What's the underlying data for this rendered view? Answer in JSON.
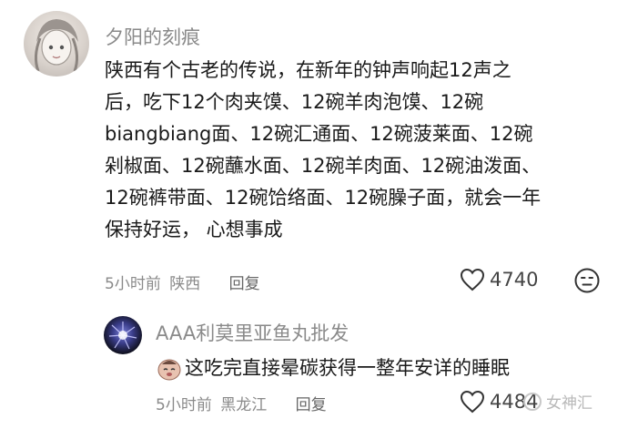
{
  "comment": {
    "username": "夕阳的刻痕",
    "lines": [
      "陕西有个古老的传说，在新年的钟声响起12声之",
      "后，吃下12个肉夹馍、12碗羊肉泡馍、12碗",
      "biangbiang面、12碗汇通面、12碗菠莱面、12碗",
      "剁椒面、12碗蘸水面、12碗羊肉面、12碗油泼面、",
      "12碗裤带面、12碗饸络面、12碗臊子面，就会一年",
      "保持好运， 心想事成"
    ],
    "time": "5小时前",
    "location": "陕西",
    "reply_label": "回复",
    "likes": "4740"
  },
  "reply": {
    "username": "AAA利莫里亚鱼丸批发",
    "text": "这吃完直接晕碳获得一整年安详的睡眠",
    "time": "5小时前",
    "location": "黑龙江",
    "reply_label": "回复",
    "likes": "4484"
  },
  "watermark": "女神汇",
  "icons": {
    "like": "heart-icon",
    "dislike": "dislike-face-icon",
    "emoji": "sleepy-face-emoji"
  }
}
